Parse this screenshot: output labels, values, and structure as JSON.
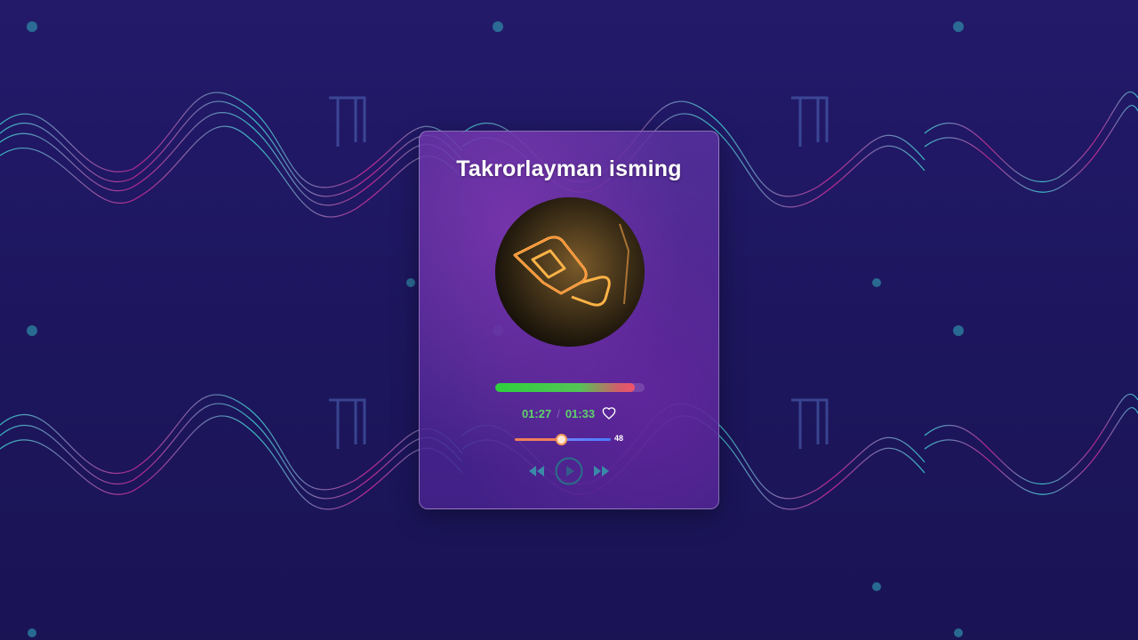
{
  "player": {
    "title": "Takrorlayman isming",
    "current_time": "01:27",
    "separator": "/",
    "duration": "01:33",
    "progress_fraction": 0.935,
    "volume_value": "48",
    "volume_fraction": 0.48,
    "liked": false
  },
  "icons": {
    "like": "heart-outline-icon",
    "rewind": "rewind-icon",
    "play": "play-circle-icon",
    "forward": "fast-forward-icon",
    "cover_art": "neon-logo-cover"
  },
  "colors": {
    "background": "#1c1560",
    "wave_cyan": "#3fd6d6",
    "wave_magenta": "#d42a9a",
    "progress_start": "#2ed03c",
    "progress_end": "#f0526b",
    "time_text": "#5fd26b",
    "volume_left": "#f07f5b",
    "volume_right": "#4a7dff",
    "control_icon": "#2a7a9a"
  }
}
